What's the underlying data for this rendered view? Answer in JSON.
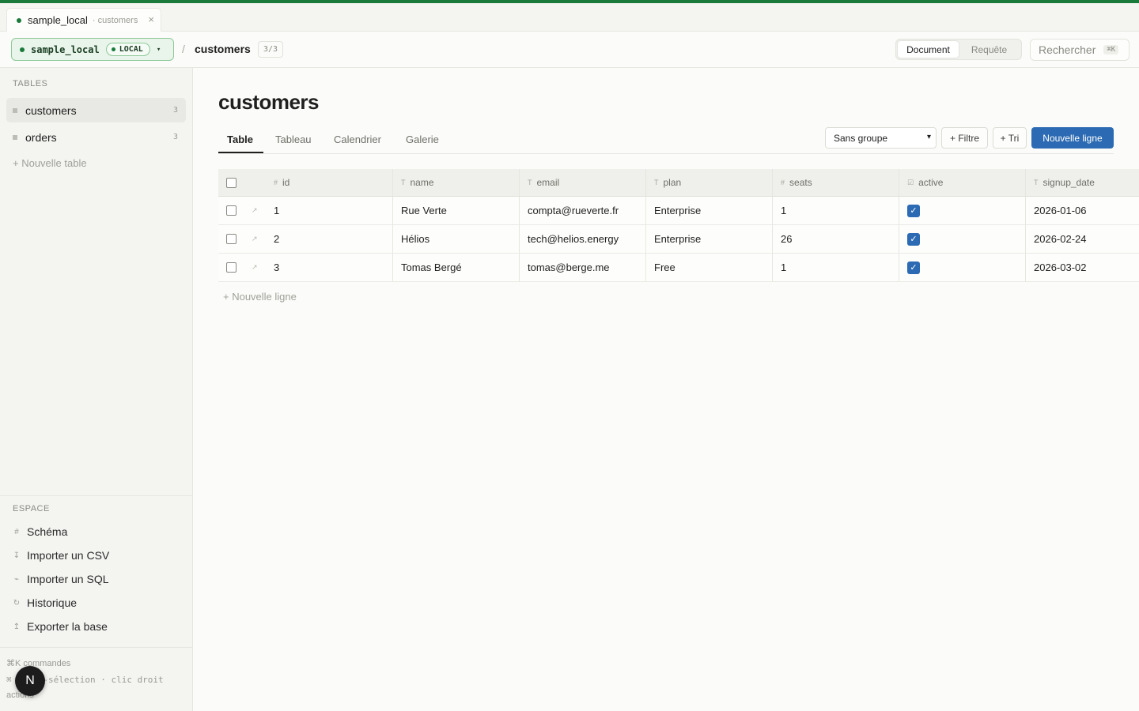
{
  "window_tab": {
    "name": "sample_local",
    "sub": "· customers",
    "close": "×"
  },
  "header": {
    "db_name": "sample_local",
    "db_badge": "LOCAL",
    "crumb_sep": "/",
    "table": "customers",
    "count": "3/3",
    "modes": [
      "Document",
      "Requête"
    ],
    "active_mode": "Document",
    "search_label": "Rechercher",
    "search_kbd": "⌘K"
  },
  "sidebar": {
    "tables_title": "TABLES",
    "tables": [
      {
        "name": "customers",
        "count": "3"
      },
      {
        "name": "orders",
        "count": "3"
      }
    ],
    "new_table": "+ Nouvelle table",
    "space_title": "ESPACE",
    "space_items": [
      {
        "icon": "#",
        "label": "Schéma"
      },
      {
        "icon": "↧",
        "label": "Importer un CSV"
      },
      {
        "icon": "⌁",
        "label": "Importer un SQL"
      },
      {
        "icon": "↻",
        "label": "Historique"
      },
      {
        "icon": "↥",
        "label": "Exporter la base"
      }
    ],
    "hints": [
      "⌘K commandes",
      "⌘ multi-sélection · clic droit",
      "actions"
    ],
    "avatar": "N"
  },
  "main": {
    "title": "customers",
    "views": [
      "Table",
      "Tableau",
      "Calendrier",
      "Galerie"
    ],
    "active_view": "Table",
    "group_select": "Sans groupe",
    "filter_btn": "+ Filtre",
    "sort_btn": "+ Tri",
    "new_row_btn": "Nouvelle ligne",
    "add_row": "+ Nouvelle ligne"
  },
  "grid": {
    "columns": [
      {
        "type": "#",
        "name": "id"
      },
      {
        "type": "T",
        "name": "name"
      },
      {
        "type": "T",
        "name": "email"
      },
      {
        "type": "T",
        "name": "plan"
      },
      {
        "type": "#",
        "name": "seats"
      },
      {
        "type": "☑",
        "name": "active"
      },
      {
        "type": "T",
        "name": "signup_date"
      }
    ],
    "rows": [
      [
        "1",
        "Rue Verte",
        "compta@rueverte.fr",
        "Enterprise",
        "1",
        true,
        "2026-01-06"
      ],
      [
        "2",
        "Hélios",
        "tech@helios.energy",
        "Enterprise",
        "26",
        true,
        "2026-02-24"
      ],
      [
        "3",
        "Tomas Bergé",
        "tomas@berge.me",
        "Free",
        "1",
        true,
        "2026-03-02"
      ]
    ]
  },
  "colors": {
    "brand_green": "#1a7a3c",
    "accent_blue": "#2c6bb3"
  }
}
